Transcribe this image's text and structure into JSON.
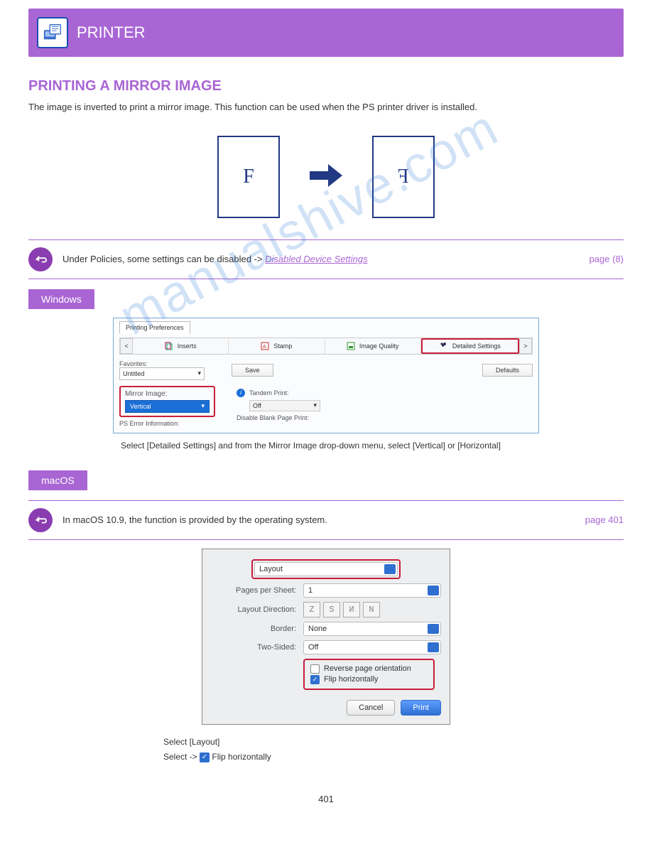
{
  "header": {
    "printer_label": "PRINTER"
  },
  "section": {
    "title": "PRINTING A MIRROR IMAGE",
    "body": "The image is inverted to print a mirror image. This function can be used when the PS printer driver is installed.",
    "page_left_char": "F",
    "page_right_char": "F"
  },
  "callouts": {
    "policies_prefix": "Under Policies, some settings can be disabled ->",
    "policies_link": "Disabled Device Settings",
    "policies_page": "page ",
    "policies_pagenum": "(8)",
    "mac_text": "In macOS 10.9, the function is provided by the operating system.",
    "mac_page": "page 401"
  },
  "os": {
    "windows": "Windows",
    "mac": "macOS"
  },
  "win_dialog": {
    "tab": "Printing Preferences",
    "nav_prev": "<",
    "nav_next": ">",
    "tabs": {
      "inserts": "Inserts",
      "stamp": "Stamp",
      "image_quality": "Image Quality",
      "detailed": "Detailed Settings"
    },
    "favorites_label": "Favorites:",
    "favorites_value": "Untitled",
    "save_btn": "Save",
    "defaults_btn": "Defaults",
    "mirror_label": "Mirror Image:",
    "mirror_value": "Vertical",
    "pserror_label": "PS Error Information:",
    "tandem_label": "Tandem Print:",
    "tandem_value": "Off",
    "disable_blank": "Disable Blank Page Print:"
  },
  "win_instruction": "Select [Detailed Settings] and from the Mirror Image drop-down menu, select [Vertical] or [Horizontal]",
  "mac_dialog": {
    "topdrop": "Layout",
    "pps_label": "Pages per Sheet:",
    "pps_value": "1",
    "ldir_label": "Layout Direction:",
    "ldir_opts": [
      "Z",
      "S",
      "И",
      "N"
    ],
    "border_label": "Border:",
    "border_value": "None",
    "twosided_label": "Two-Sided:",
    "twosided_value": "Off",
    "reverse_label": "Reverse page orientation",
    "flip_label": "Flip horizontally",
    "cancel_btn": "Cancel",
    "print_btn": "Print"
  },
  "mac_instruction_line1": "Select [Layout]",
  "mac_instruction_line2_prefix": "Select -> ",
  "mac_instruction_line2_suffix": " Flip horizontally",
  "watermark": "manualshive.com",
  "footer_page": "401"
}
